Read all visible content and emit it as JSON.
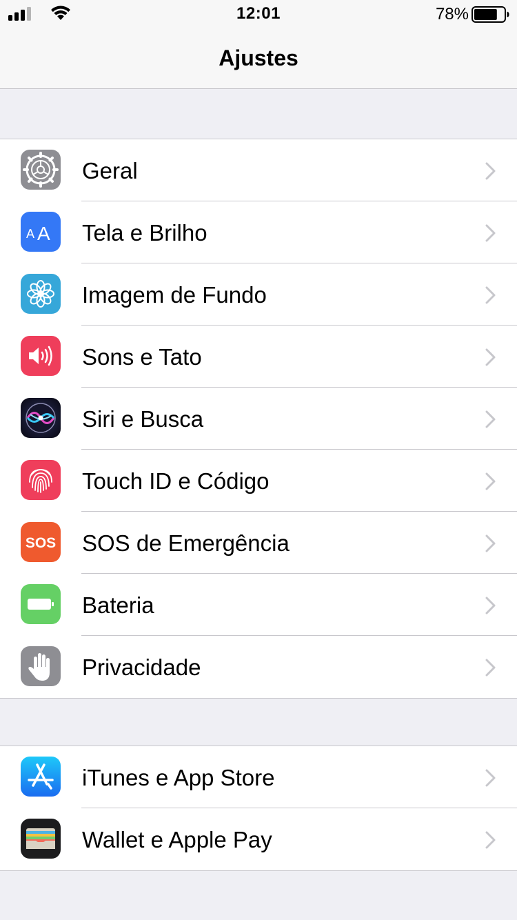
{
  "status_bar": {
    "time": "12:01",
    "battery_percent": "78%",
    "battery_level": 0.78
  },
  "nav": {
    "title": "Ajustes"
  },
  "groups": [
    {
      "items": [
        {
          "label": "Geral",
          "icon": "gear-icon",
          "color": "#8e8e93"
        },
        {
          "label": "Tela e Brilho",
          "icon": "display-brightness-icon",
          "icon_text": "AA",
          "color": "#3478f6"
        },
        {
          "label": "Imagem de Fundo",
          "icon": "wallpaper-flower-icon",
          "color": "#36a7d9"
        },
        {
          "label": "Sons e Tato",
          "icon": "speaker-icon",
          "color": "#ef3e5b"
        },
        {
          "label": "Siri e Busca",
          "icon": "siri-icon",
          "color": "#1c1c3a"
        },
        {
          "label": "Touch ID e Código",
          "icon": "fingerprint-icon",
          "color": "#ef3e5b"
        },
        {
          "label": "SOS de Emergência",
          "icon": "sos-icon",
          "icon_text": "SOS",
          "color": "#ef5a2e"
        },
        {
          "label": "Bateria",
          "icon": "battery-icon",
          "color": "#65d065"
        },
        {
          "label": "Privacidade",
          "icon": "hand-icon",
          "color": "#8e8e93"
        }
      ]
    },
    {
      "items": [
        {
          "label": "iTunes e App Store",
          "icon": "app-store-icon",
          "color": "#2a8ef5"
        },
        {
          "label": "Wallet e Apple Pay",
          "icon": "wallet-icon",
          "color": "#1c1c1e"
        }
      ]
    }
  ]
}
